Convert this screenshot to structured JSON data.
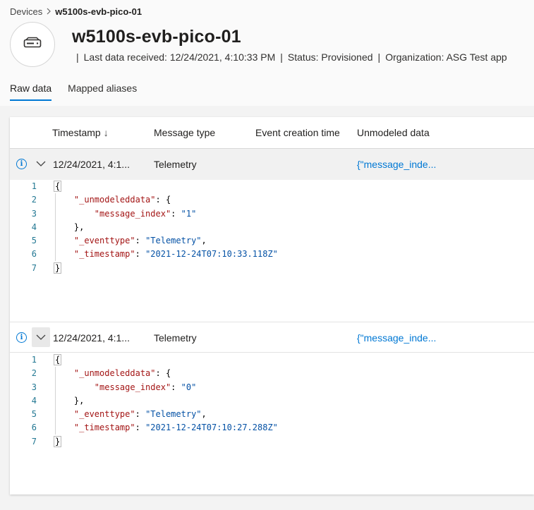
{
  "breadcrumb": {
    "parent": "Devices",
    "separator": ">",
    "current": "w5100s-evb-pico-01"
  },
  "device": {
    "icon": "device-icon",
    "title": "w5100s-evb-pico-01",
    "meta": {
      "last_received": "Last data received: 12/24/2021, 4:10:33 PM",
      "status": "Status: Provisioned",
      "organization": "Organization: ASG Test app"
    }
  },
  "tabs": [
    {
      "label": "Raw data",
      "active": true
    },
    {
      "label": "Mapped aliases",
      "active": false
    }
  ],
  "grid": {
    "columns": [
      "Timestamp",
      "Message type",
      "Event creation time",
      "Unmodeled data"
    ],
    "sort_indicator": "↓",
    "rows": [
      {
        "timestamp": "12/24/2021, 4:1...",
        "message_type": "Telemetry",
        "event_creation_time": "",
        "unmodeled": "{\"message_inde...",
        "code": {
          "line_numbers": [
            "1",
            "2",
            "3",
            "4",
            "5",
            "6",
            "7"
          ],
          "open": "{",
          "unmodeled_key": "\"_unmodeleddata\"",
          "index_key": "\"message_index\"",
          "index_val": "\"1\"",
          "close_inner": "},",
          "eventtype_key": "\"_eventtype\"",
          "eventtype_val": "\"Telemetry\"",
          "timestamp_key": "\"_timestamp\"",
          "timestamp_val": "\"2021-12-24T07:10:33.118Z\"",
          "close": "}"
        }
      },
      {
        "timestamp": "12/24/2021, 4:1...",
        "message_type": "Telemetry",
        "event_creation_time": "",
        "unmodeled": "{\"message_inde...",
        "code": {
          "line_numbers": [
            "1",
            "2",
            "3",
            "4",
            "5",
            "6",
            "7"
          ],
          "open": "{",
          "unmodeled_key": "\"_unmodeleddata\"",
          "index_key": "\"message_index\"",
          "index_val": "\"0\"",
          "close_inner": "},",
          "eventtype_key": "\"_eventtype\"",
          "eventtype_val": "\"Telemetry\"",
          "timestamp_key": "\"_timestamp\"",
          "timestamp_val": "\"2021-12-24T07:10:27.288Z\"",
          "close": "}"
        }
      }
    ]
  },
  "colors": {
    "accent": "#0078d4",
    "json_key": "#a31515",
    "json_string": "#0451a5",
    "line_number": "#237893"
  }
}
